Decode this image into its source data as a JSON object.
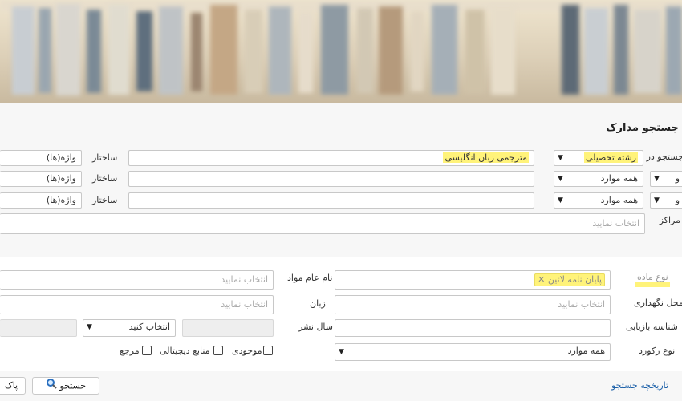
{
  "header": {
    "title": "جستجو مدارک"
  },
  "search_rows": [
    {
      "label_right": "جستجو در",
      "op_value": "",
      "field_value": "رشته تحصیلی",
      "term_value": "مترجمی زبان انگلیسی",
      "structure_label": "ساختار",
      "structure_value": "واژه(ها)"
    },
    {
      "label_right": "",
      "op_value": "و",
      "field_value": "همه موارد",
      "term_value": "",
      "structure_label": "ساختار",
      "structure_value": "واژه(ها)"
    },
    {
      "label_right": "",
      "op_value": "و",
      "field_value": "همه موارد",
      "term_value": "",
      "structure_label": "ساختار",
      "structure_value": "واژه(ها)"
    }
  ],
  "centers": {
    "label": "مراکز",
    "placeholder": "انتخاب نمایید"
  },
  "filters": {
    "material_type": {
      "label": "نوع ماده",
      "tag": "پایان نامه لاتین"
    },
    "general_material": {
      "label": "نام عام مواد",
      "placeholder": "انتخاب نمایید"
    },
    "location": {
      "label": "محل نگهداری",
      "placeholder": "انتخاب نمایید"
    },
    "language": {
      "label": "زبان",
      "placeholder": "انتخاب نمایید"
    },
    "call_number": {
      "label": "شناسه بازیابی",
      "value": ""
    },
    "pub_year": {
      "label": "سال نشر",
      "value": "",
      "select": "انتخاب کنید"
    },
    "record_type": {
      "label": "نوع رکورد",
      "value": "همه موارد"
    },
    "checkboxes": [
      {
        "label": "موجودی",
        "checked": false
      },
      {
        "label": "منابع دیجیتالی",
        "checked": false
      },
      {
        "label": "مرجع",
        "checked": false
      }
    ]
  },
  "footer": {
    "history_link": "تاریخچه جستجو",
    "search_button": "جستجو",
    "clear_button": "پاک"
  },
  "colors": {
    "highlight": "#fff37a",
    "link": "#1a5fa8",
    "panel_bg": "#f7f7f7"
  }
}
